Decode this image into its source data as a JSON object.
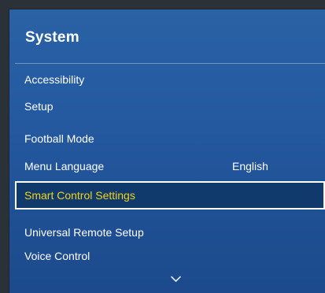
{
  "panel": {
    "title": "System"
  },
  "menu": {
    "items": [
      {
        "label": "Accessibility"
      },
      {
        "label": "Setup"
      },
      {
        "label": "Football Mode"
      },
      {
        "label": "Menu Language",
        "value": "English"
      },
      {
        "label": "Smart Control Settings",
        "selected": true
      },
      {
        "label": "Universal Remote Setup"
      },
      {
        "label": "Voice Control"
      }
    ]
  },
  "colors": {
    "panel_blue": "#2459a0",
    "selected_bg": "#103a6c",
    "selected_text": "#f2d21b",
    "text": "#ffffff",
    "outer_bg": "#2b3138"
  },
  "icons": {
    "scroll_more": "chevron-down-icon"
  }
}
